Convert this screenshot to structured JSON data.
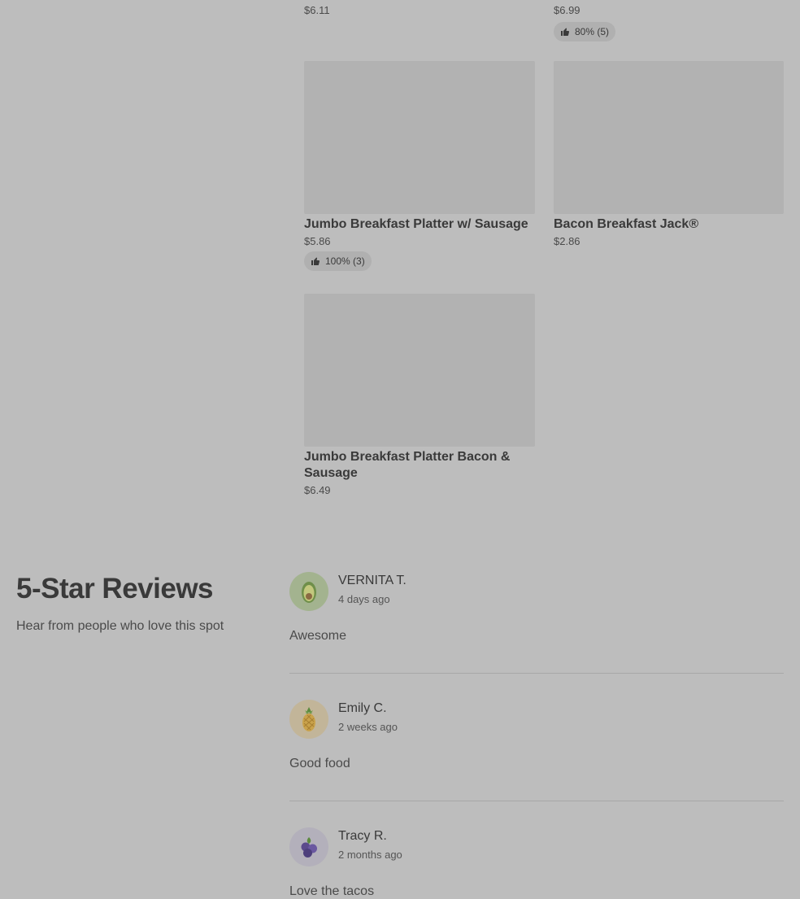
{
  "menu": {
    "top_items": [
      {
        "price": "$6.11"
      },
      {
        "price": "$6.99",
        "rating": "80% (5)"
      }
    ],
    "items": [
      {
        "name": "Jumbo Breakfast Platter w/ Sausage",
        "price": "$5.86",
        "rating": "100% (3)"
      },
      {
        "name": "Bacon Breakfast Jack®",
        "price": "$2.86"
      },
      {
        "name_line1": "Jumbo Breakfast Platter Bacon &",
        "name_line2": "Sausage",
        "price": "$6.49"
      }
    ]
  },
  "reviews_section": {
    "title": "5-Star Reviews",
    "subtitle": "Hear from people who love this spot",
    "reviews": [
      {
        "name": "VERNITA T.",
        "date": "4 days ago",
        "text": "Awesome",
        "avatar_icon": "avocado-icon"
      },
      {
        "name": "Emily C.",
        "date": "2 weeks ago",
        "text": "Good food",
        "avatar_icon": "pineapple-icon"
      },
      {
        "name": "Tracy R.",
        "date": "2 months ago",
        "text": "Love the tacos",
        "avatar_icon": "blueberry-icon"
      }
    ]
  },
  "colors": {
    "overlay_bg": "#bdbdbd",
    "avatar_green": "#a3b38f",
    "avatar_tan": "#c2b599",
    "avatar_purple": "#b3b0bb"
  }
}
